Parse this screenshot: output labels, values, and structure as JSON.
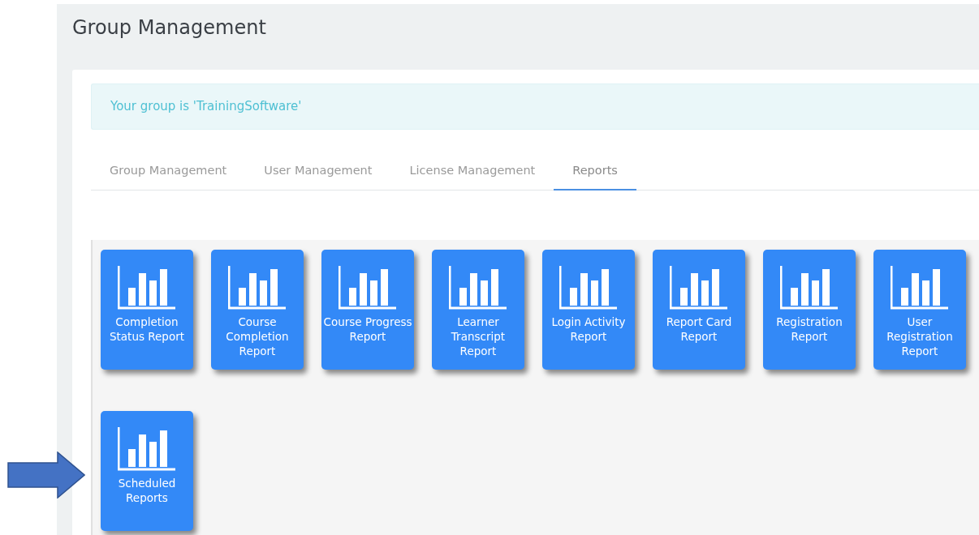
{
  "page_title": "Group Management",
  "alert": "Your group is 'TrainingSoftware'",
  "tabs": [
    {
      "label": "Group Management",
      "selected": false
    },
    {
      "label": "User Management",
      "selected": false
    },
    {
      "label": "License Management",
      "selected": false
    },
    {
      "label": "Reports",
      "selected": true
    }
  ],
  "reports": [
    {
      "label": "Completion Status Report"
    },
    {
      "label": "Course Completion Report"
    },
    {
      "label": "Course Progress Report"
    },
    {
      "label": "Learner Transcript Report"
    },
    {
      "label": "Login Activity Report"
    },
    {
      "label": "Report Card Report"
    },
    {
      "label": "Registration Report"
    },
    {
      "label": "User Registration Report"
    },
    {
      "label": "Scheduled Reports"
    }
  ]
}
